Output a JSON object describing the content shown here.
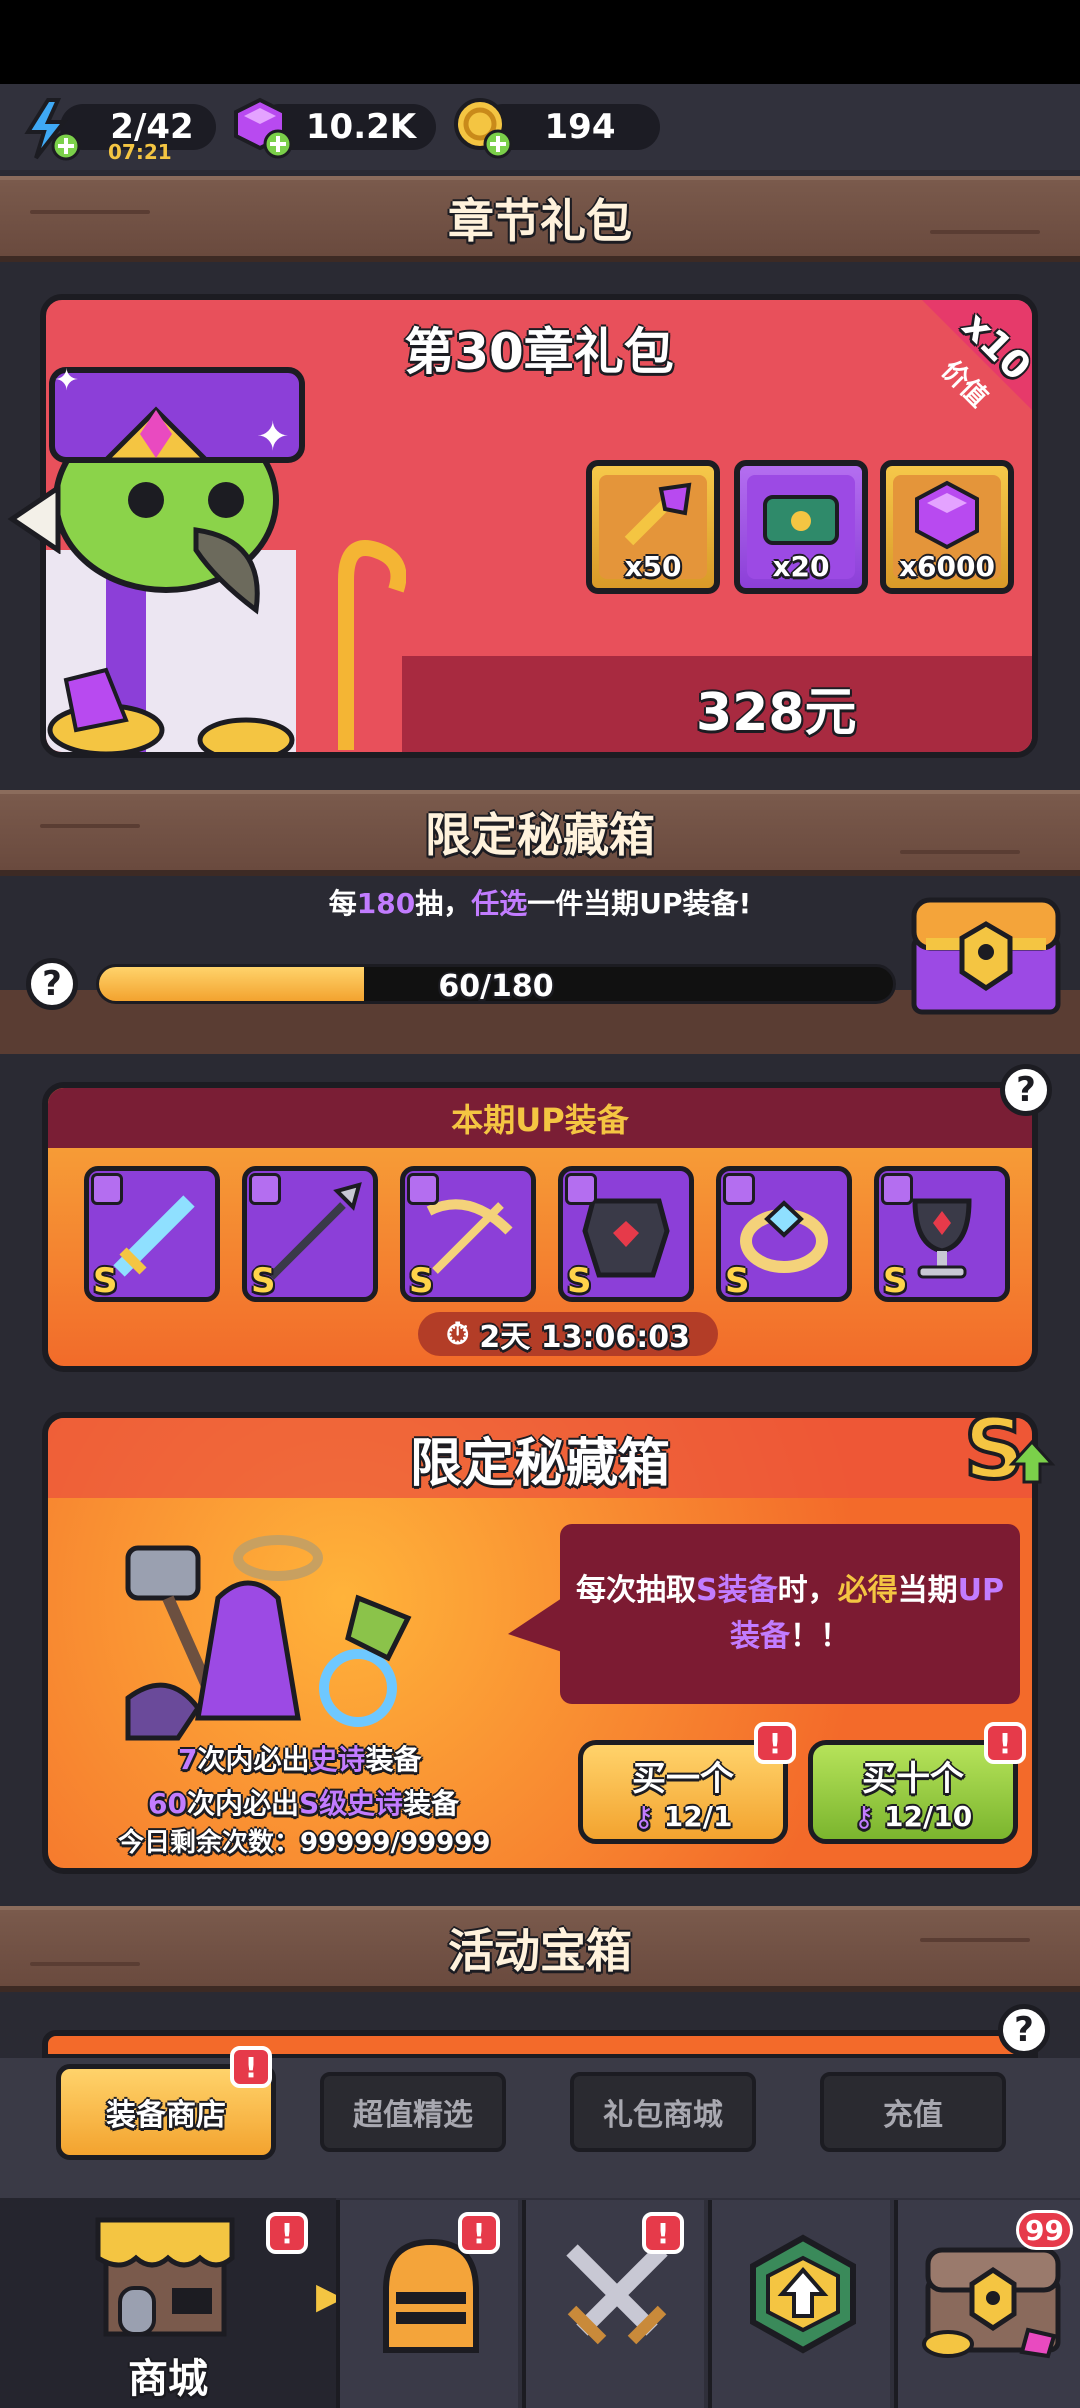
{
  "currency": {
    "energy": {
      "value": "2/42",
      "timer": "07:21"
    },
    "gems": {
      "value": "10.2K"
    },
    "coins": {
      "value": "194"
    }
  },
  "sections": {
    "chapter_gift": "章节礼包",
    "limited_chest": "限定秘藏箱",
    "event_chest": "活动宝箱"
  },
  "chapter_gift": {
    "title": "第30章礼包",
    "ribbon_multiplier": "x10",
    "ribbon_label": "价值",
    "items": [
      {
        "icon": "magic-key-icon",
        "qty": "x50"
      },
      {
        "icon": "paw-chest-icon",
        "qty": "x20"
      },
      {
        "icon": "purple-gem-icon",
        "qty": "x6000"
      }
    ],
    "price": "328元"
  },
  "limited_chest": {
    "desc_prefix": "每",
    "desc_num": "180",
    "desc_mid": "抽，",
    "desc_pick": "任选",
    "desc_suffix": "一件当期UP装备!",
    "progress_text": "60/180",
    "progress_value": 60,
    "progress_max": 180
  },
  "up_equipment": {
    "title": "本期UP装备",
    "items": [
      {
        "icon": "sword-icon",
        "grade": "S"
      },
      {
        "icon": "spear-icon",
        "grade": "S"
      },
      {
        "icon": "crossbow-icon",
        "grade": "S"
      },
      {
        "icon": "armor-icon",
        "grade": "S"
      },
      {
        "icon": "ring-icon",
        "grade": "S"
      },
      {
        "icon": "chalice-icon",
        "grade": "S"
      }
    ],
    "timer": "2天 13:06:03"
  },
  "chest_panel": {
    "title": "限定秘藏箱",
    "bubble_a": "每次抽取",
    "bubble_b": "S装备",
    "bubble_c": "时，",
    "bubble_d": "必得",
    "bubble_e": "当期",
    "bubble_f": "UP",
    "bubble_g": "装备",
    "bubble_h": "！！",
    "line1_num": "7",
    "line1_a": "次内必出",
    "line1_b": "史诗",
    "line1_c": "装备",
    "line2_num": "60",
    "line2_a": "次内必出",
    "line2_b": "S级史诗",
    "line2_c": "装备",
    "remaining": "今日剩余次数：99999/99999",
    "buy_one": {
      "label": "买一个",
      "cost": "12/1"
    },
    "buy_ten": {
      "label": "买十个",
      "cost": "12/10"
    }
  },
  "shop_tabs": [
    "装备商店",
    "超值精选",
    "礼包商城",
    "充值"
  ],
  "bottom_nav": {
    "shop_label": "商城",
    "chest_badge": "99"
  },
  "colors": {
    "accent_purple": "#a855f7",
    "gold": "#f4c542",
    "alert_red": "#e63a4a"
  }
}
